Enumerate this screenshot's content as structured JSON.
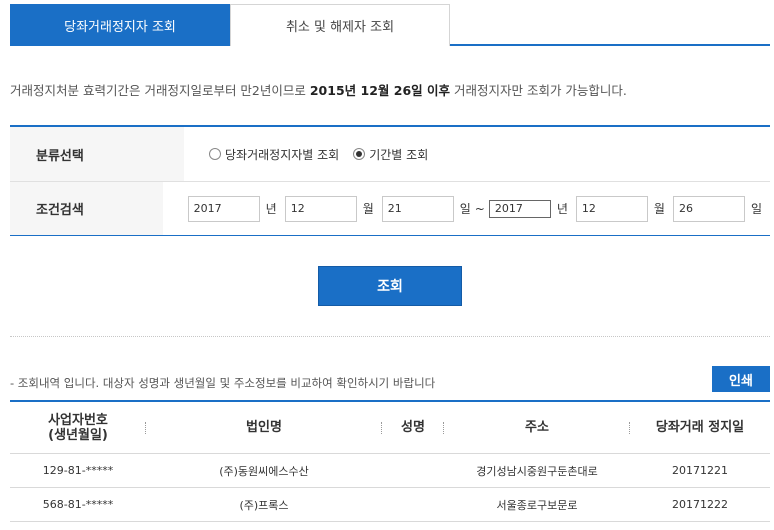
{
  "tabs": [
    {
      "label": "당좌거래정지자 조회",
      "active": true
    },
    {
      "label": "취소 및 해제자 조회",
      "active": false
    }
  ],
  "notice": {
    "prefix": "거래정지처분 효력기간은 거래정지일로부터 만2년이므로 ",
    "bold": "2015년 12월 26일 이후",
    "suffix": " 거래정지자만 조회가 가능합니다."
  },
  "form": {
    "category_label": "분류선택",
    "radio_by_person": "당좌거래정지자별 조회",
    "radio_by_period": "기간별 조회",
    "selected_radio": "기간별 조회",
    "search_label": "조건검색",
    "from": {
      "year": "2017",
      "month": "12",
      "day": "21"
    },
    "to": {
      "year": "2017",
      "month": "12",
      "day": "26"
    },
    "unit_year": "년",
    "unit_month": "월",
    "unit_day": "일",
    "tilde": "~"
  },
  "search_button": "조회",
  "results": {
    "note": "- 조회내역 입니다. 대상자 성명과 생년월일 및 주소정보를 비교하여 확인하시기 바랍니다",
    "print_button": "인쇄",
    "columns": [
      "사업자번호",
      "(생년월일)",
      "법인명",
      "성명",
      "주소",
      "당좌거래 정지일"
    ],
    "rows": [
      {
        "bizno": "129-81-*****",
        "corp": "(주)동원씨에스수산",
        "name": "",
        "addr": "경기성남시중원구둔촌대로",
        "date": "20171221"
      },
      {
        "bizno": "568-81-*****",
        "corp": "(주)프록스",
        "name": "",
        "addr": "서울종로구보문로",
        "date": "20171222"
      }
    ]
  }
}
